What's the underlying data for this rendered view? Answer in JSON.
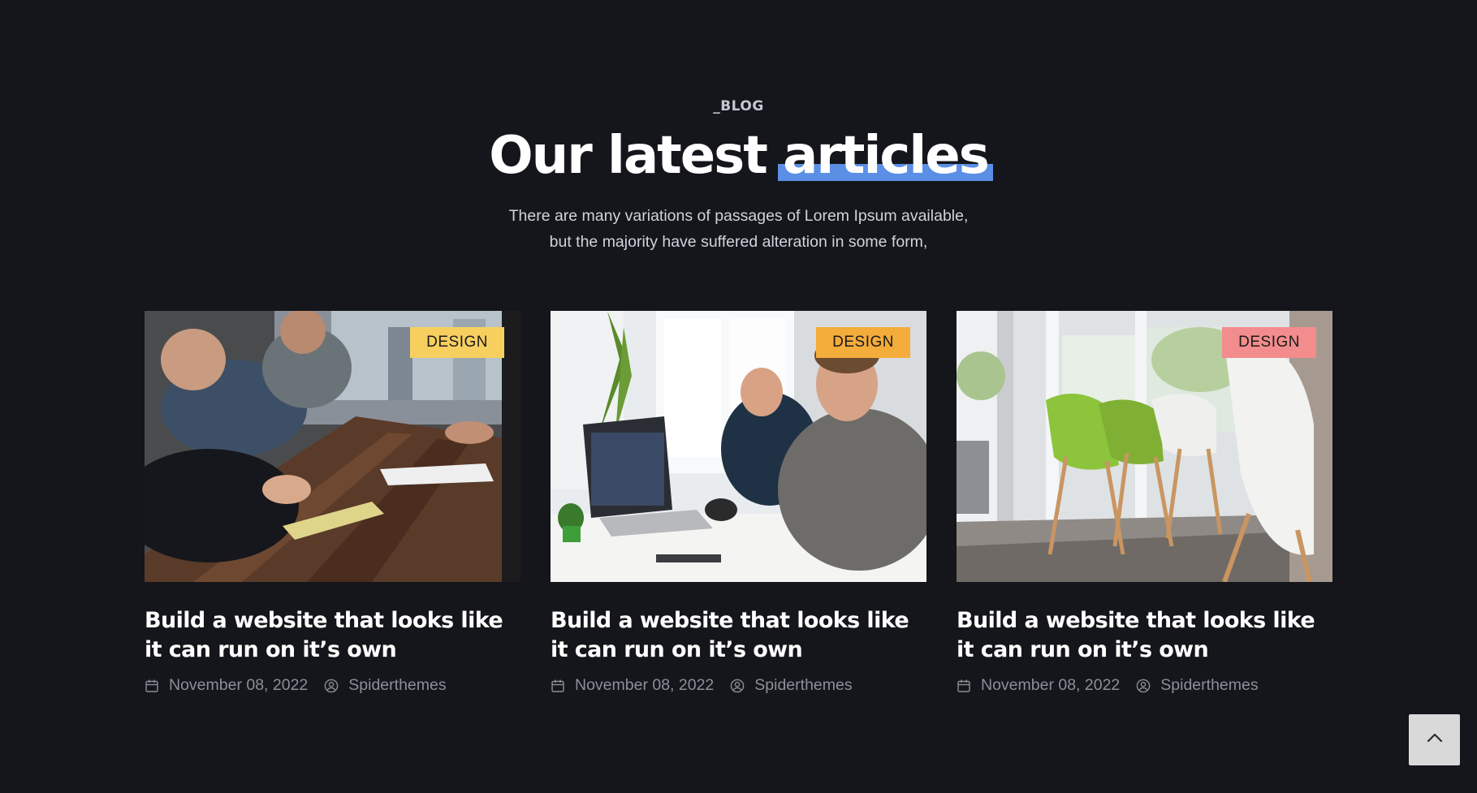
{
  "section": {
    "eyebrow": "_BLOG",
    "title_main": "Our latest ",
    "title_highlight": "articles",
    "subtitle_line1": "There are many variations of passages of Lorem Ipsum available,",
    "subtitle_line2": "but the majority have suffered alteration in some form,"
  },
  "colors": {
    "background": "#14161b",
    "highlight": "#5b8fe6",
    "tag_yellow": "#f6cf5f",
    "tag_orange": "#f4ac3b",
    "tag_pink": "#f38c8c"
  },
  "posts": [
    {
      "tag": "DESIGN",
      "tag_color": "#f6cf5f",
      "image": "team-meeting-at-wooden-table",
      "title": "Build a website that looks like it can run on it’s own",
      "date": "November 08, 2022",
      "author": "Spiderthemes"
    },
    {
      "tag": "DESIGN",
      "tag_color": "#f4ac3b",
      "image": "developers-working-on-laptops",
      "title": "Build a website that looks like it can run on it’s own",
      "date": "November 08, 2022",
      "author": "Spiderthemes"
    },
    {
      "tag": "DESIGN",
      "tag_color": "#f38c8c",
      "image": "office-with-green-chairs",
      "title": "Build a website that looks like it can run on it’s own",
      "date": "November 08, 2022",
      "author": "Spiderthemes"
    }
  ],
  "icons": {
    "date": "calendar-icon",
    "author": "user-circle-icon",
    "back_to_top": "chevron-up-icon"
  }
}
